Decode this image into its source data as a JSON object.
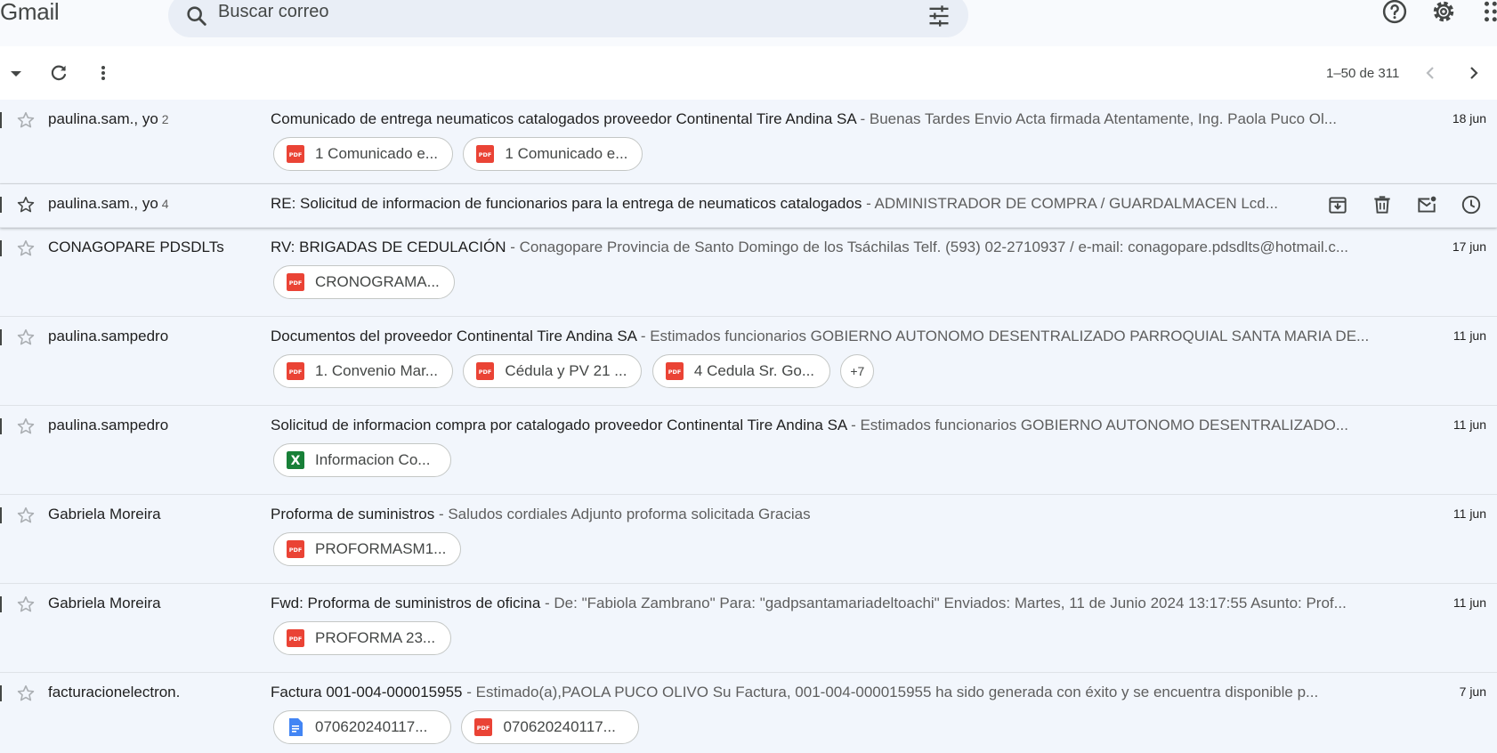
{
  "app": {
    "logo": "Gmail"
  },
  "search": {
    "placeholder": "Buscar correo"
  },
  "pager": {
    "range": "1–50 de 311"
  },
  "emails": [
    {
      "sender": "paulina.sam., yo",
      "count": "2",
      "subject": "Comunicado de entrega neumaticos catalogados proveedor Continental Tire Andina SA",
      "snippet": " - Buenas Tardes Envio Acta firmada Atentamente, Ing. Paola Puco Ol...",
      "date": "18 jun",
      "attachments": [
        {
          "type": "pdf",
          "name": "1 Comunicado e..."
        },
        {
          "type": "pdf",
          "name": "1 Comunicado e..."
        }
      ]
    },
    {
      "sender": "paulina.sam., yo",
      "count": "4",
      "subject": "RE: Solicitud de informacion de funcionarios para la entrega de neumaticos catalogados",
      "snippet": " - ADMINISTRADOR DE COMPRA / GUARDALMACEN Lcd...",
      "date": "",
      "attachments": []
    },
    {
      "sender": "CONAGOPARE PDSDLTs",
      "count": "",
      "subject": "RV: BRIGADAS DE CEDULACIÓN",
      "snippet": " - Conagopare Provincia de Santo Domingo de los Tsáchilas Telf. (593) 02-2710937 / e-mail: conagopare.pdsdlts@hotmail.c...",
      "date": "17 jun",
      "attachments": [
        {
          "type": "pdf",
          "name": "CRONOGRAMA..."
        }
      ]
    },
    {
      "sender": "paulina.sampedro",
      "count": "",
      "subject": "Documentos del proveedor Continental Tire Andina SA",
      "snippet": " - Estimados funcionarios GOBIERNO AUTONOMO DESENTRALIZADO PARROQUIAL SANTA MARIA DE...",
      "date": "11 jun",
      "attachments": [
        {
          "type": "pdf",
          "name": "1. Convenio Mar..."
        },
        {
          "type": "pdf",
          "name": "Cédula y PV 21 ..."
        },
        {
          "type": "pdf",
          "name": "4 Cedula Sr. Go..."
        }
      ],
      "more": "+7"
    },
    {
      "sender": "paulina.sampedro",
      "count": "",
      "subject": "Solicitud de informacion compra por catalogado proveedor Continental Tire Andina SA",
      "snippet": " - Estimados funcionarios GOBIERNO AUTONOMO DESENTRALIZADO...",
      "date": "11 jun",
      "attachments": [
        {
          "type": "xls",
          "name": "Informacion Co..."
        }
      ]
    },
    {
      "sender": "Gabriela Moreira",
      "count": "",
      "subject": "Proforma de suministros",
      "snippet": " - Saludos cordiales Adjunto proforma solicitada Gracias",
      "date": "11 jun",
      "attachments": [
        {
          "type": "pdf",
          "name": "PROFORMASM1..."
        }
      ]
    },
    {
      "sender": "Gabriela Moreira",
      "count": "",
      "subject": "Fwd: Proforma de suministros de oficina",
      "snippet": " - De: \"Fabiola Zambrano\" Para: \"gadpsantamariadeltoachi\" Enviados: Martes, 11 de Junio 2024 13:17:55 Asunto: Prof...",
      "date": "11 jun",
      "attachments": [
        {
          "type": "pdf",
          "name": "PROFORMA 23..."
        }
      ]
    },
    {
      "sender": "facturacionelectron.",
      "count": "",
      "subject": "Factura 001-004-000015955",
      "snippet": " - Estimado(a),PAOLA PUCO OLIVO Su Factura, 001-004-000015955 ha sido generada con éxito y se encuentra disponible p...",
      "date": "7 jun",
      "attachments": [
        {
          "type": "doc",
          "name": "070620240117..."
        },
        {
          "type": "pdf",
          "name": "070620240117..."
        }
      ]
    }
  ],
  "colors": {
    "pdf": "#ea4335",
    "xls": "#188038",
    "doc": "#4285f4",
    "rowBg": "#f2f6fc",
    "chipBorder": "#c4c7c5"
  }
}
